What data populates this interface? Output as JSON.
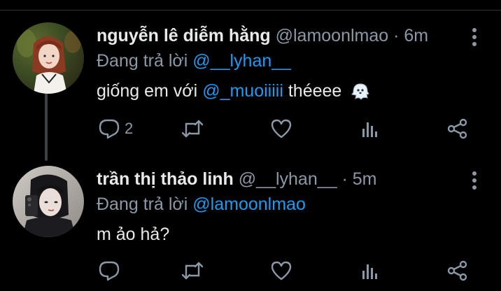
{
  "tweets": [
    {
      "display_name": "nguyễn lê diễm hằng",
      "handle": "@lamoonlmao",
      "separator": "·",
      "time": "6m",
      "reply_prefix": "Đang trả lời",
      "reply_to": "@__lyhan__",
      "text_before": "giống em với",
      "text_mention": "@_muoiiiii",
      "text_after": "théeee",
      "emoji": "ghost-emoji",
      "reply_count": "2"
    },
    {
      "display_name": "trần thị thảo linh",
      "handle": "@__lyhan__",
      "separator": "·",
      "time": "5m",
      "reply_prefix": "Đang trả lời",
      "reply_to": "@lamoonlmao",
      "text": "m ảo hả?",
      "reply_count": ""
    }
  ],
  "icons": {
    "reply": "reply-icon",
    "retweet": "retweet-icon",
    "like": "heart-icon",
    "stats": "stats-icon",
    "share": "share-icon",
    "more": "more-vertical-icon"
  },
  "colors": {
    "background": "#000000",
    "text": "#e7e9ea",
    "muted": "#8b98a5",
    "link": "#1d9bf0",
    "divider": "#2f3336"
  }
}
